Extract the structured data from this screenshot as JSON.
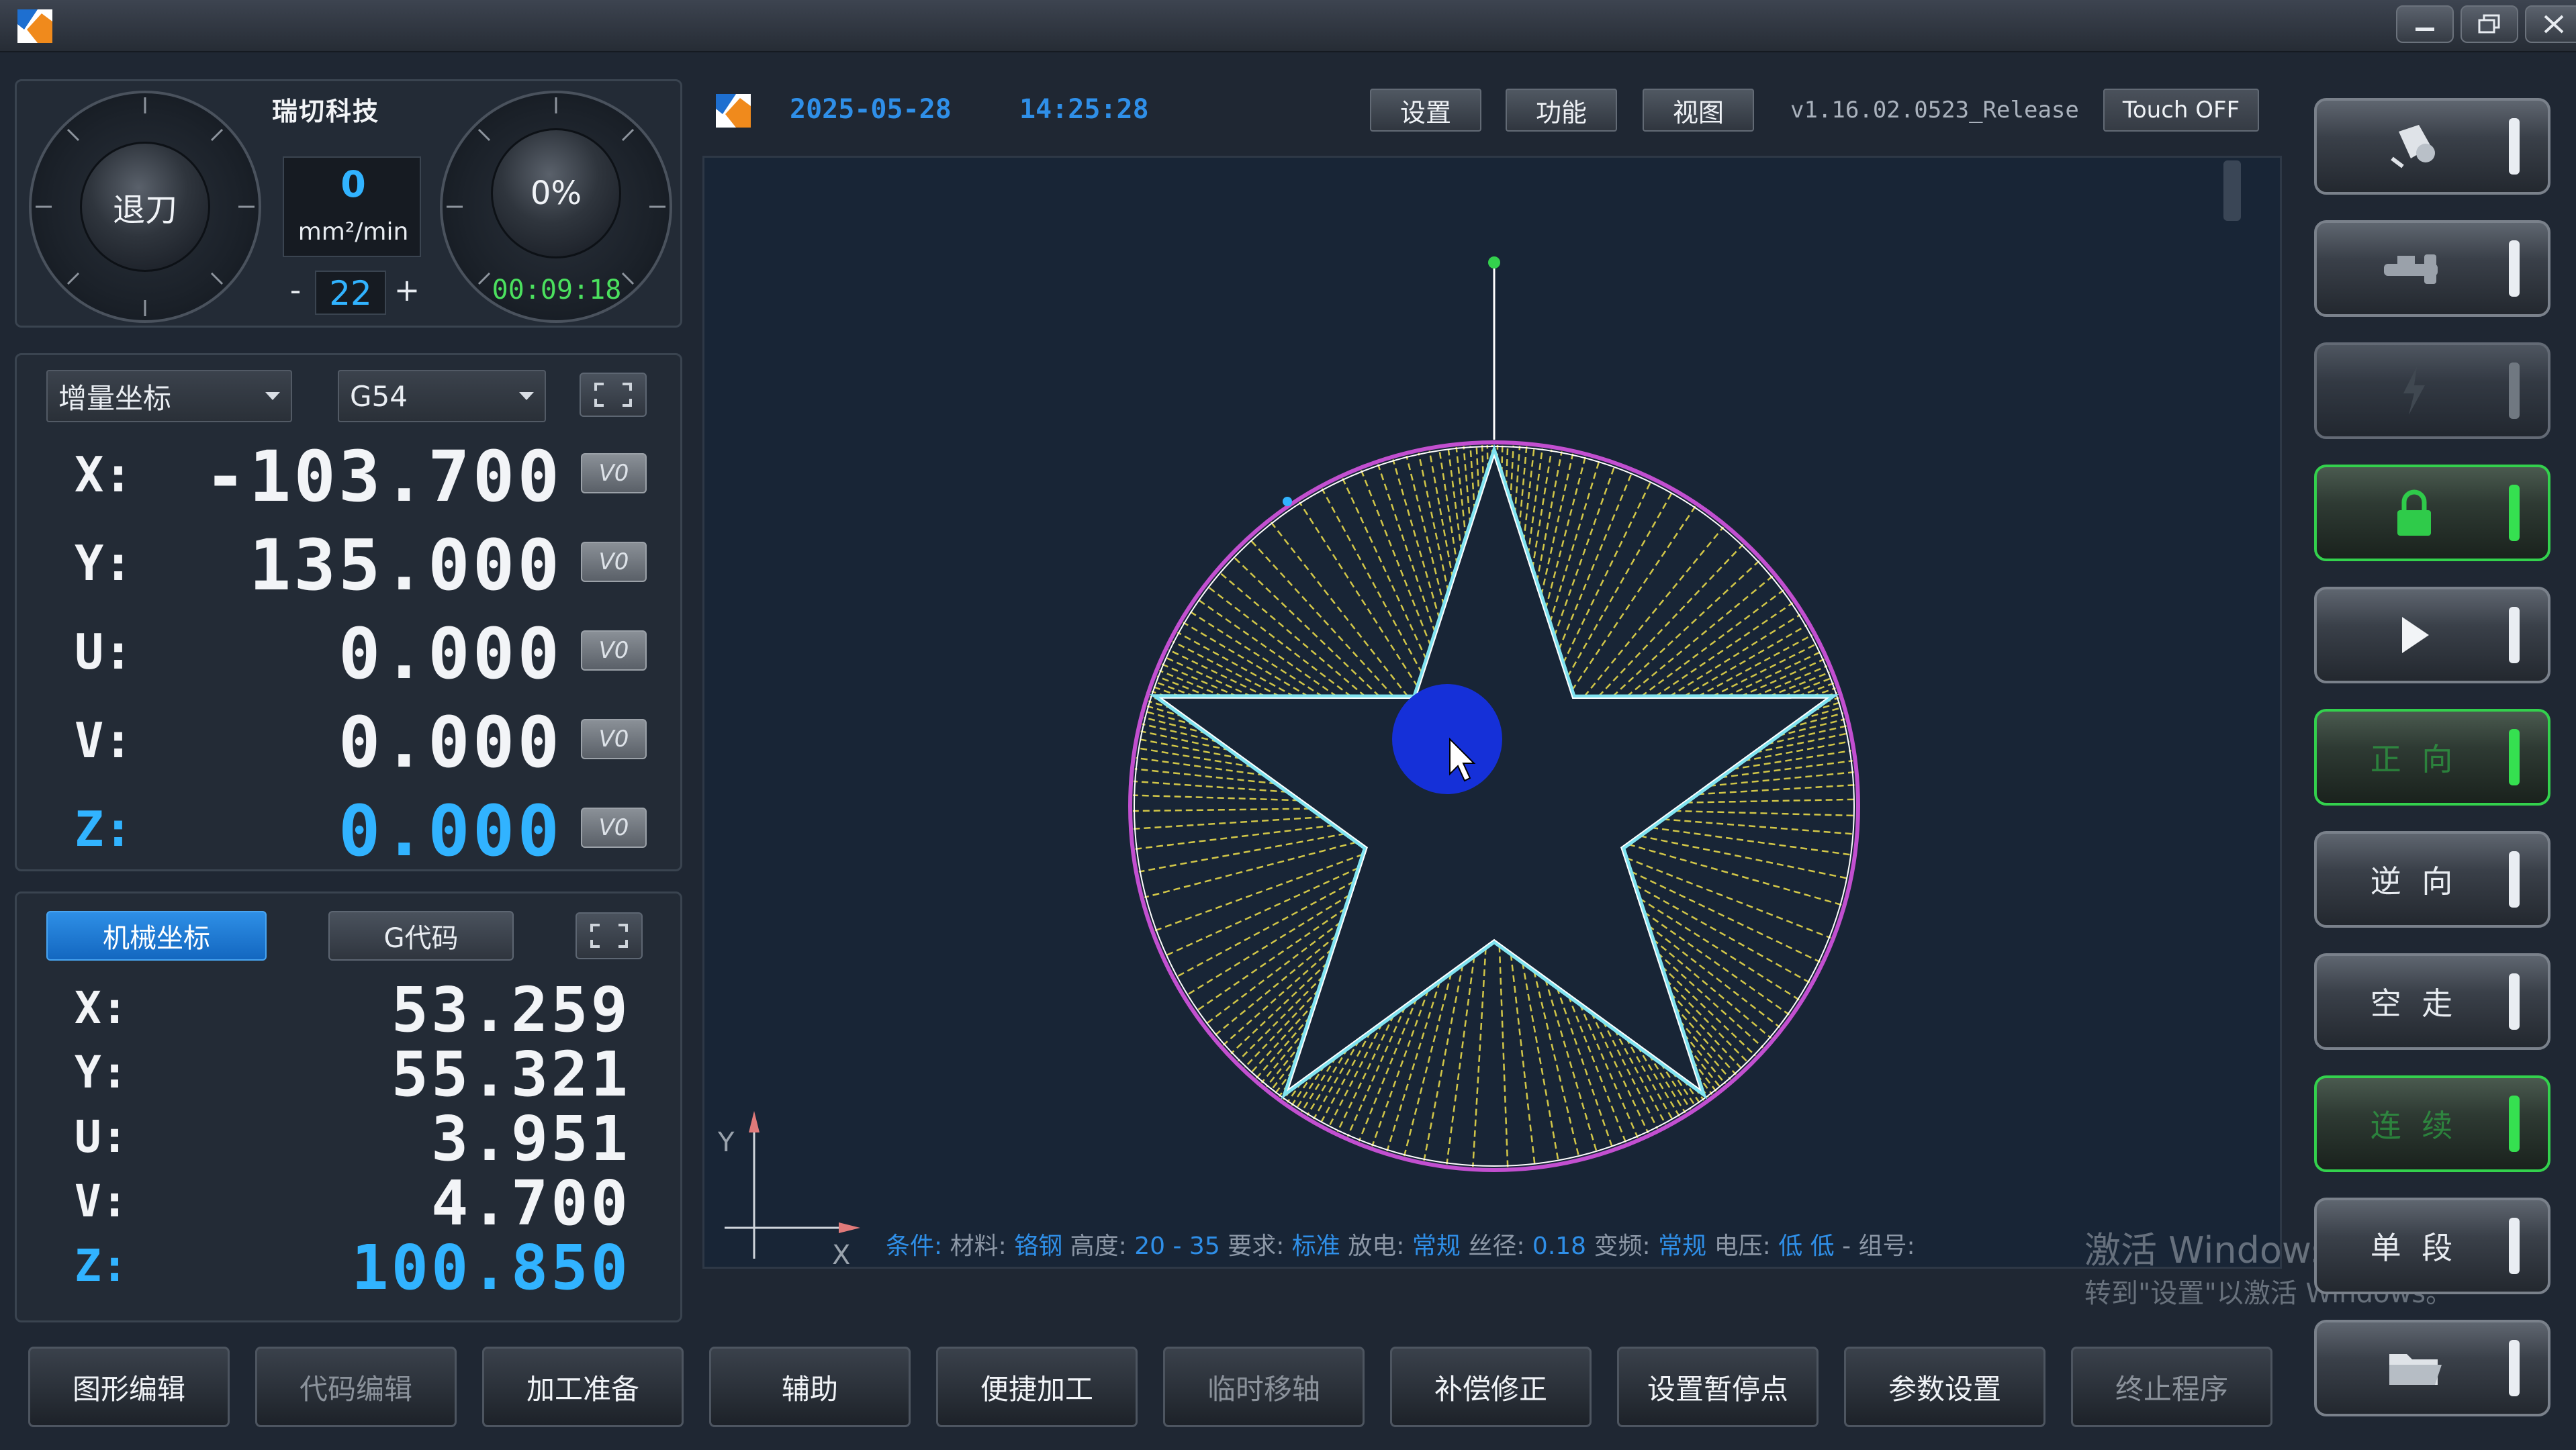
{
  "titlebar": {
    "window_controls": [
      {
        "name": "minimize-icon"
      },
      {
        "name": "restore-icon"
      },
      {
        "name": "close-icon"
      }
    ]
  },
  "dials": {
    "brand": "瑞切科技",
    "left_knob_label": "退刀",
    "speed_value": "0",
    "speed_unit": "mm²/min",
    "step_minus": "-",
    "step_value": "22",
    "step_plus": "+",
    "right_knob_label": "0%",
    "timer": "00:09:18"
  },
  "coord_panel": {
    "mode_select": "增量坐标",
    "wcs_select": "G54",
    "v0_label": "V0",
    "axes": [
      {
        "label": "X:",
        "value": "-103.700"
      },
      {
        "label": "Y:",
        "value": "135.000"
      },
      {
        "label": "U:",
        "value": "0.000"
      },
      {
        "label": "V:",
        "value": "0.000"
      },
      {
        "label": "Z:",
        "value": "0.000"
      }
    ]
  },
  "machine_panel": {
    "tab_machine": "机械坐标",
    "tab_gcode": "G代码",
    "axes": [
      {
        "label": "X:",
        "value": "53.259"
      },
      {
        "label": "Y:",
        "value": "55.321"
      },
      {
        "label": "U:",
        "value": "3.951"
      },
      {
        "label": "V:",
        "value": "4.700"
      },
      {
        "label": "Z:",
        "value": "100.850"
      }
    ]
  },
  "toolbar": {
    "date": "2025-05-28",
    "time": "14:25:28",
    "settings": "设置",
    "function": "功能",
    "view": "视图",
    "version": "v1.16.02.0523_Release",
    "touch_off": "Touch OFF"
  },
  "canvas": {
    "axis_x": "X",
    "axis_y": "Y"
  },
  "status": {
    "cond_label": "条件:",
    "material_label": "材料:",
    "material_value": "铬钢",
    "height_label": "高度:",
    "height_value": "20 - 35",
    "require_label": "要求:",
    "require_value": "标准",
    "discharge_label": "放电:",
    "discharge_value": "常规",
    "wire_label": "丝径:",
    "wire_value": "0.18",
    "freq_label": "变频:",
    "freq_value": "常规",
    "voltage_label": "电压:",
    "voltage_value": "低 低",
    "group_label": "- 组号:"
  },
  "watermark": {
    "line1": "激活 Windows",
    "line2": "转到\"设置\"以激活 Windows。"
  },
  "side_buttons": [
    {
      "name": "lamp-toggle",
      "icon": "lamp-icon",
      "label": ""
    },
    {
      "name": "pump-toggle",
      "icon": "faucet-icon",
      "label": ""
    },
    {
      "name": "power-toggle",
      "icon": "lightning-icon",
      "label": ""
    },
    {
      "name": "lock-toggle",
      "icon": "lock-icon",
      "label": ""
    },
    {
      "name": "run-toggle",
      "icon": "play-icon",
      "label": ""
    },
    {
      "name": "forward-toggle",
      "icon": "",
      "label": "正 向"
    },
    {
      "name": "reverse-toggle",
      "icon": "",
      "label": "逆 向"
    },
    {
      "name": "dry-run-toggle",
      "icon": "",
      "label": "空 走"
    },
    {
      "name": "continuous-toggle",
      "icon": "",
      "label": "连 续"
    },
    {
      "name": "single-step-toggle",
      "icon": "",
      "label": "单 段"
    },
    {
      "name": "open-file-toggle",
      "icon": "folder-icon",
      "label": ""
    }
  ],
  "bottom_buttons": [
    {
      "label": "图形编辑"
    },
    {
      "label": "代码编辑"
    },
    {
      "label": "加工准备"
    },
    {
      "label": "辅助"
    },
    {
      "label": "便捷加工"
    },
    {
      "label": "临时移轴"
    },
    {
      "label": "补偿修正"
    },
    {
      "label": "设置暂停点"
    },
    {
      "label": "参数设置"
    },
    {
      "label": "终止程序"
    }
  ],
  "colors": {
    "background": "#1f2733",
    "accent_blue": "#31b3ff",
    "active_green": "#33d14d",
    "path_cyan": "#7fe3f0",
    "circle_magenta": "#c24fd0",
    "hatch_yellow": "#e6d84a"
  }
}
